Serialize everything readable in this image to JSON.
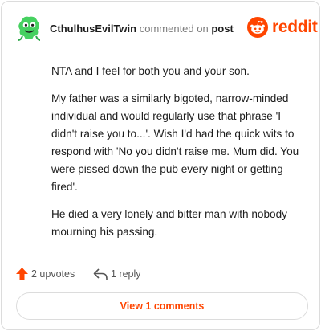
{
  "header": {
    "username": "CthulhusEvilTwin",
    "action": "commented on",
    "target": "post",
    "brand": "reddit"
  },
  "comment": {
    "paragraphs": [
      "NTA and I feel for both you and your son.",
      "My father was a similarly bigoted, narrow-minded individual and would regularly use that phrase 'I didn't raise you to...'. Wish I'd had the quick wits to respond with 'No you didn't raise me. Mum did. You were pissed down the pub every night or getting fired'.",
      "He died a very lonely and bitter man with nobody mourning his passing."
    ]
  },
  "footer": {
    "upvotes_label": "2 upvotes",
    "replies_label": "1 reply",
    "view_comments_label": "View 1 comments"
  },
  "colors": {
    "brand": "#ff4500",
    "muted_text": "#7c7c7c",
    "avatar_green": "#46d160"
  },
  "icons": {
    "avatar": "snoo-avatar-icon",
    "brand": "reddit-snoo-icon",
    "upvote": "upvote-arrow-icon",
    "reply": "reply-arrow-icon"
  }
}
